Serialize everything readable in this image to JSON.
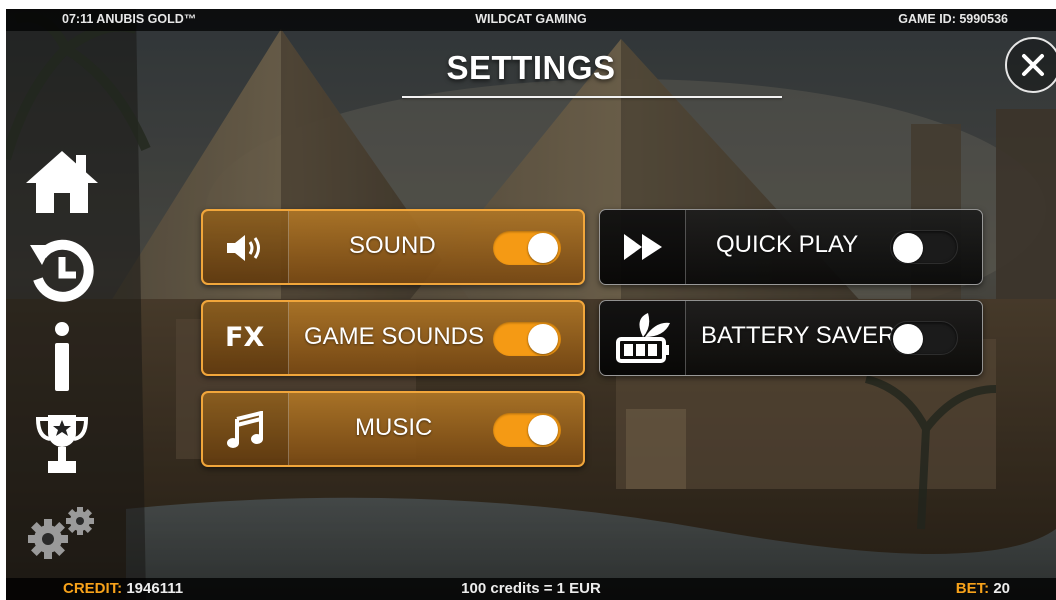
{
  "topbar": {
    "left": "07:11 ANUBIS GOLD™",
    "center": "WILDCAT GAMING",
    "right": "GAME ID: 5990536"
  },
  "title": "SETTINGS",
  "close_label": "×",
  "sidebar": [
    "home-icon",
    "history-icon",
    "info-icon",
    "trophy-icon",
    "settings-gears-icon"
  ],
  "settings": {
    "sound": {
      "label": "SOUND",
      "enabled": true,
      "icon": "speaker-icon"
    },
    "game_sounds": {
      "label": "GAME SOUNDS",
      "enabled": true,
      "icon_text": "FX"
    },
    "music": {
      "label": "MUSIC",
      "enabled": true,
      "icon": "music-note-icon"
    },
    "quick_play": {
      "label": "QUICK PLAY",
      "enabled": false,
      "icon": "fast-forward-icon"
    },
    "battery_saver": {
      "label": "BATTERY SAVER",
      "enabled": false,
      "icon": "eco-battery-icon"
    }
  },
  "footer": {
    "credit_label": "CREDIT:",
    "credit_value": "1946111",
    "rate": "100 credits = 1 EUR",
    "bet_label": "BET:",
    "bet_value": "20"
  },
  "colors": {
    "accent": "#f59a14",
    "panel_active": "#a86d22",
    "panel_inactive": "#121212"
  }
}
